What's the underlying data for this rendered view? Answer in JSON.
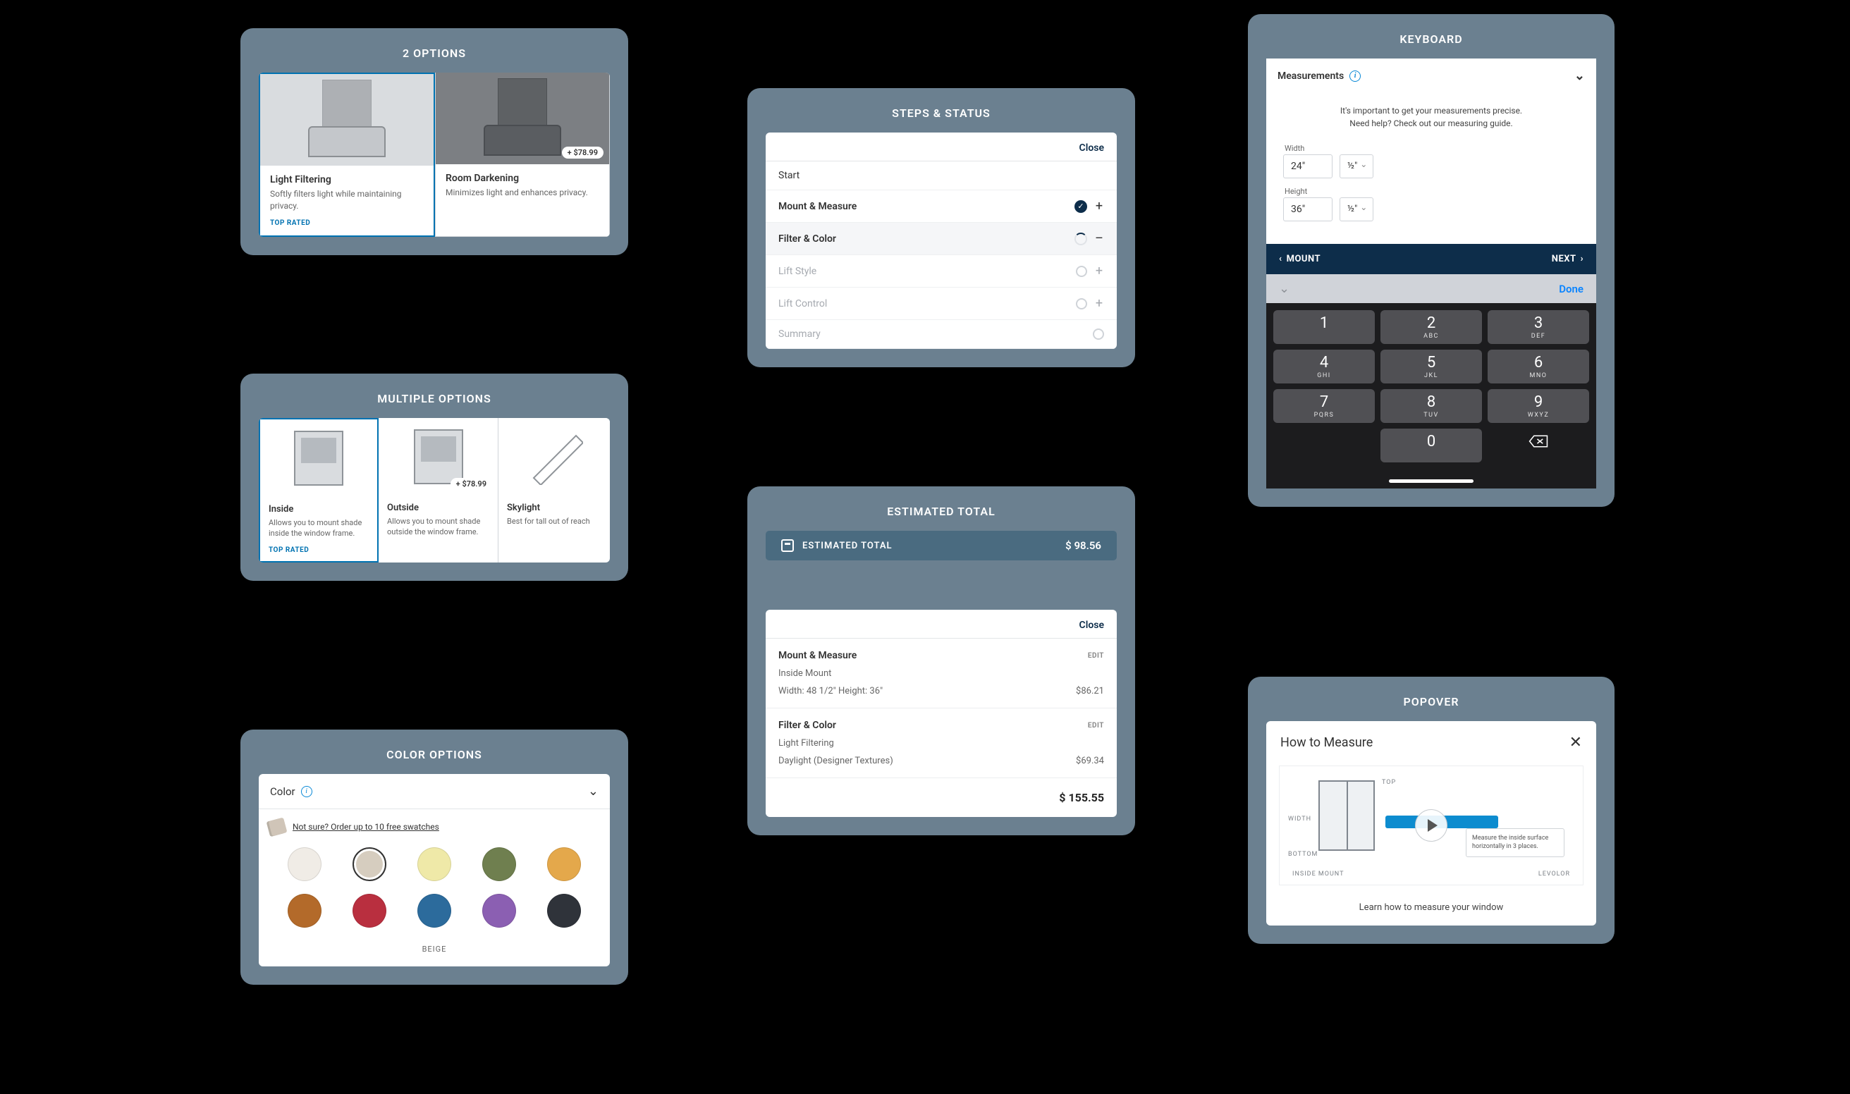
{
  "panel_titles": {
    "two_options": "2 OPTIONS",
    "multiple": "MULTIPLE OPTIONS",
    "color": "COLOR OPTIONS",
    "steps": "STEPS & STATUS",
    "estimated": "ESTIMATED TOTAL",
    "keyboard": "KEYBOARD",
    "popover": "POPOVER"
  },
  "two_options": [
    {
      "title": "Light Filtering",
      "desc": "Softly filters light while maintaining privacy.",
      "top_rated": "TOP RATED",
      "selected": true
    },
    {
      "title": "Room Darkening",
      "desc": "Minimizes light and enhances privacy.",
      "price": "+ $78.99",
      "selected": false
    }
  ],
  "multiple": [
    {
      "title": "Inside",
      "desc": "Allows you to mount shade inside the window frame.",
      "top_rated": "TOP RATED",
      "selected": true
    },
    {
      "title": "Outside",
      "desc": "Allows you to mount shade outside the window frame.",
      "price": "+ $78.99"
    },
    {
      "title": "Skylight",
      "desc": "Best for tall out of reach"
    }
  ],
  "color_panel": {
    "heading": "Color",
    "swatch_msg": "Not sure? Order up to 10 free swatches",
    "selected_name": "BEIGE",
    "swatches": [
      {
        "hex": "#f0ece6"
      },
      {
        "hex": "#d6cdbf",
        "selected": true
      },
      {
        "hex": "#efe9a8"
      },
      {
        "hex": "#6f7f4f"
      },
      {
        "hex": "#e4a84b"
      },
      {
        "hex": "#b36a2a"
      },
      {
        "hex": "#b92f3f"
      },
      {
        "hex": "#2c6b9c"
      },
      {
        "hex": "#8b5fb2"
      },
      {
        "hex": "#2f333a"
      }
    ]
  },
  "steps": {
    "close": "Close",
    "rows": [
      {
        "label": "Start",
        "state": "none"
      },
      {
        "label": "Mount & Measure",
        "state": "done",
        "toggle": "+"
      },
      {
        "label": "Filter & Color",
        "state": "loading",
        "toggle": "–",
        "active": true
      },
      {
        "label": "Lift Style",
        "state": "empty",
        "toggle": "+",
        "muted": true
      },
      {
        "label": "Lift Control",
        "state": "empty",
        "toggle": "+",
        "muted": true
      },
      {
        "label": "Summary",
        "state": "empty",
        "muted": true
      }
    ]
  },
  "estimated": {
    "pill_label": "ESTIMATED TOTAL",
    "pill_value": "$ 98.56",
    "close": "Close",
    "sections": [
      {
        "title": "Mount & Measure",
        "edit": "EDIT",
        "sub": "Inside Mount",
        "line_label": "Width: 48 1/2\" Height: 36\"",
        "line_value": "$86.21"
      },
      {
        "title": "Filter & Color",
        "edit": "EDIT",
        "sub": "Light Filtering",
        "line_label": "Daylight (Designer Textures)",
        "line_value": "$69.34"
      }
    ],
    "total": "$ 155.55"
  },
  "keyboard": {
    "section_title": "Measurements",
    "helper_text_1": "It's important to get your measurements precise.",
    "helper_text_2": "Need help? Check out our measuring guide.",
    "fields": [
      {
        "label": "Width",
        "value": "24\"",
        "fraction": "½\""
      },
      {
        "label": "Height",
        "value": "36\"",
        "fraction": "½\""
      }
    ],
    "nav_back": "MOUNT",
    "nav_next": "NEXT",
    "done": "Done",
    "keys": [
      [
        {
          "num": "1",
          "letters": ""
        },
        {
          "num": "2",
          "letters": "ABC"
        },
        {
          "num": "3",
          "letters": "DEF"
        }
      ],
      [
        {
          "num": "4",
          "letters": "GHI"
        },
        {
          "num": "5",
          "letters": "JKL"
        },
        {
          "num": "6",
          "letters": "MNO"
        }
      ],
      [
        {
          "num": "7",
          "letters": "PQRS"
        },
        {
          "num": "8",
          "letters": "TUV"
        },
        {
          "num": "9",
          "letters": "WXYZ"
        }
      ],
      [
        {
          "blank": true
        },
        {
          "num": "0",
          "letters": ""
        },
        {
          "backspace": true
        }
      ]
    ]
  },
  "popover": {
    "title": "How to Measure",
    "caption": "Learn how to measure your window",
    "diagram_label_width": "WIDTH",
    "diagram_label_top": "TOP",
    "diagram_label_bottom": "BOTTOM",
    "diagram_label_footer_l": "INSIDE MOUNT",
    "diagram_label_footer_r": "LEVOLOR",
    "tooltip": "Measure the inside surface horizontally in 3 places."
  }
}
